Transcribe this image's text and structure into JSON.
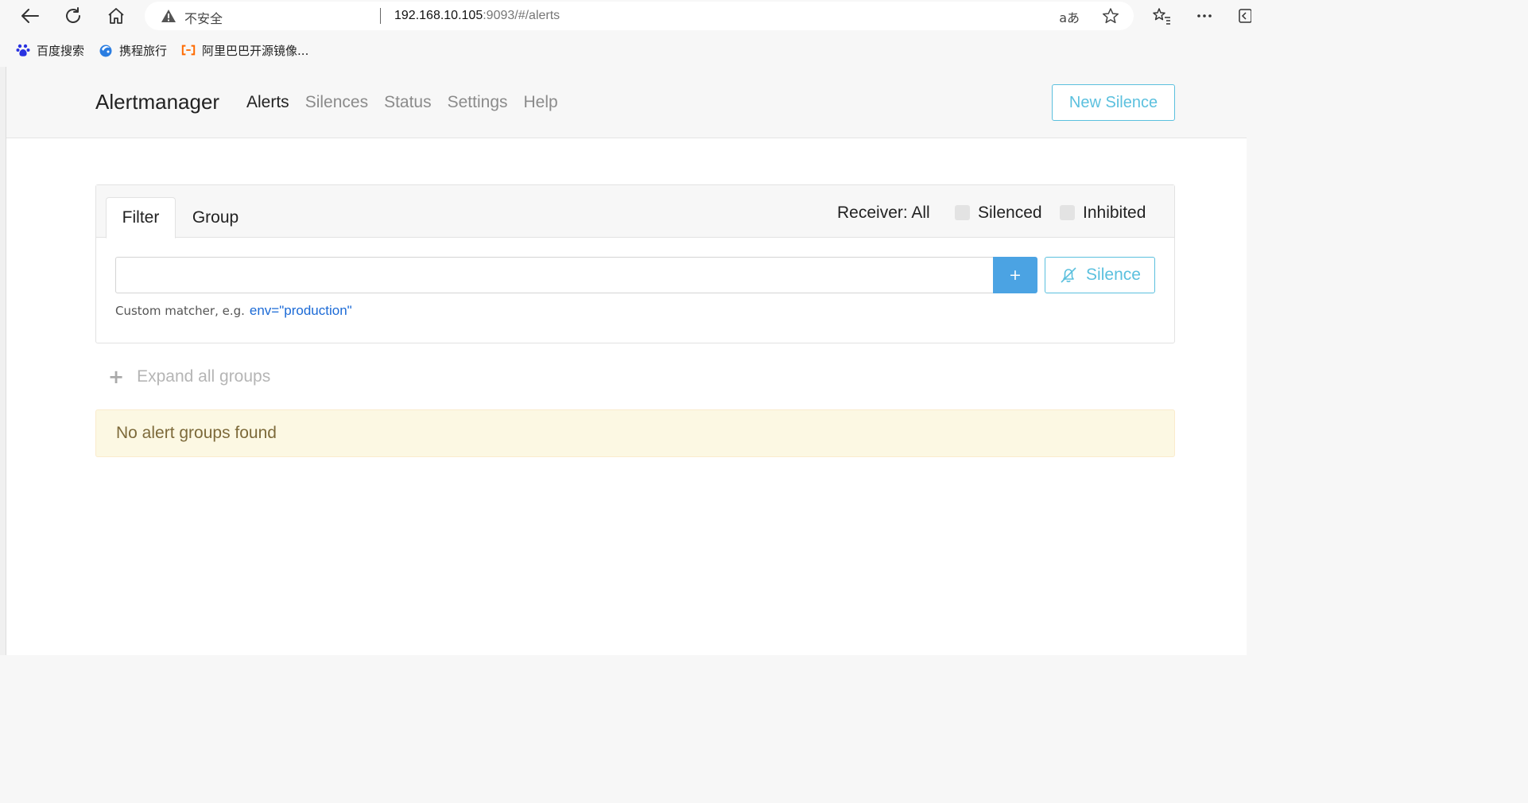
{
  "browser": {
    "security_text": "不安全",
    "url_host": "192.168.10.105",
    "url_path": ":9093/#/alerts",
    "translate_glyph": "aあ",
    "bookmarks": [
      {
        "label": "百度搜索",
        "icon": "baidu-paw-icon",
        "color": "#2932e1"
      },
      {
        "label": "携程旅行",
        "icon": "ctrip-dolphin-icon",
        "color": "#2a7de1"
      },
      {
        "label": "阿里巴巴开源镜像...",
        "icon": "aliyun-bracket-icon",
        "color": "#ff6a00"
      }
    ]
  },
  "navbar": {
    "brand": "Alertmanager",
    "links": [
      "Alerts",
      "Silences",
      "Status",
      "Settings",
      "Help"
    ],
    "active_link": "Alerts",
    "new_silence_label": "New Silence"
  },
  "filter_card": {
    "tabs": [
      "Filter",
      "Group"
    ],
    "active_tab": "Filter",
    "receiver_label": "Receiver: All",
    "silenced_label": "Silenced",
    "inhibited_label": "Inhibited",
    "silenced_checked": false,
    "inhibited_checked": false,
    "input_value": "",
    "add_button_label": "+",
    "silence_button_label": "Silence",
    "hint_text": "Custom matcher, e.g.",
    "hint_example": "env=\"production\""
  },
  "expand_all_label": "Expand all groups",
  "expand_all_glyph": "+",
  "empty_message": "No alert groups found",
  "colors": {
    "accent_info": "#5bc0de",
    "primary_button": "#4ba3e3",
    "warning_bg": "#fcf8e3",
    "warning_text": "#7d6a3a",
    "link": "#1b6ad6"
  }
}
